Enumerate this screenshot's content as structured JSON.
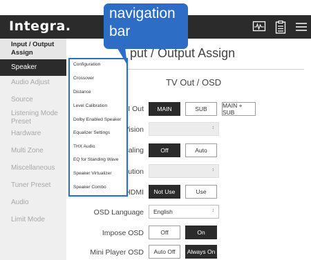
{
  "brand": {
    "logo": "Integra."
  },
  "callout": {
    "line1": "navigation",
    "line2": "bar"
  },
  "sidebar": {
    "header": "Input / Output Assign",
    "items": [
      {
        "label": "Speaker",
        "active": true
      },
      {
        "label": "Audio Adjust"
      },
      {
        "label": "Source"
      },
      {
        "label": "Listening Mode Preset"
      },
      {
        "label": "Hardware"
      },
      {
        "label": "Multi Zone"
      },
      {
        "label": "Miscellaneous"
      },
      {
        "label": "Tuner Preset"
      },
      {
        "label": "Audio"
      },
      {
        "label": "Limit Mode"
      }
    ]
  },
  "dropdown": {
    "items": [
      "Configuration",
      "Crossover",
      "Distance",
      "Level Calibration",
      "Dolby Enabled Speaker",
      "Equalizer Settings",
      "THX Audio",
      "EQ for Standing Wave",
      "Speaker Virtualizer",
      "Speaker Combo"
    ]
  },
  "main": {
    "title": "put / Output Assign",
    "section": "TV Out / OSD",
    "rows": {
      "hdmi_out": {
        "label": "MI Out",
        "options": [
          "MAIN",
          "SUB",
          "MAIN + SUB"
        ],
        "selected": "MAIN"
      },
      "vision": {
        "label": "Vision"
      },
      "scaling": {
        "label": "caling",
        "options": [
          "Off",
          "Auto"
        ],
        "selected": "Off"
      },
      "resolution": {
        "label": "lution"
      },
      "hdmi": {
        "label": "HDMI",
        "options": [
          "Not Use",
          "Use"
        ],
        "selected": "Not Use"
      },
      "osd_language": {
        "label": "OSD Language",
        "value": "English"
      },
      "impose_osd": {
        "label": "Impose OSD",
        "options": [
          "Off",
          "On"
        ],
        "selected": "On"
      },
      "mini_player_osd": {
        "label": "Mini Player OSD",
        "options": [
          "Auto Off",
          "Always On"
        ],
        "selected": "Always On"
      }
    }
  },
  "colors": {
    "accent": "#2d6dc6",
    "topbar": "#2b2b2b",
    "sidebar_bg": "#efefef"
  },
  "icons": {
    "top_right": [
      "monitor-wave-icon",
      "clipboard-icon",
      "hamburger-menu-icon"
    ],
    "select_arrow": "up-down-arrow-icon"
  }
}
